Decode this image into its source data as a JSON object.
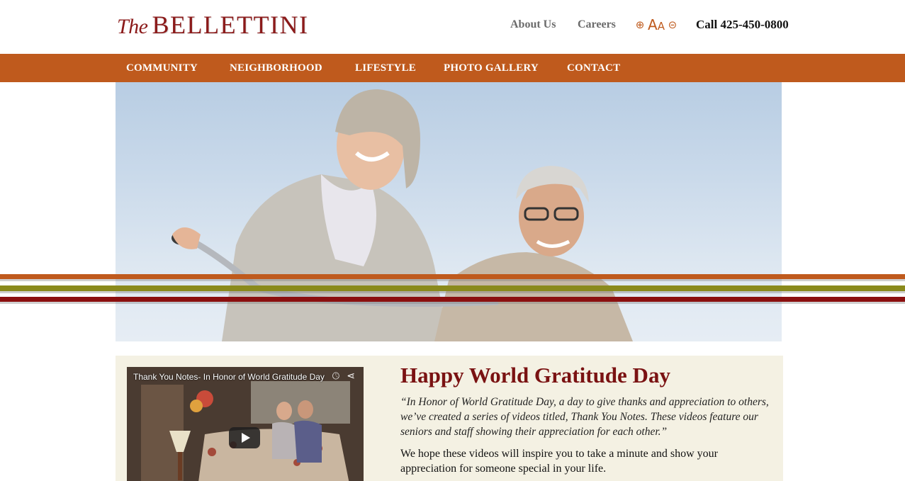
{
  "header": {
    "logo_the": "The",
    "logo_name": "BELLETTINI",
    "links": {
      "about": "About Us",
      "careers": "Careers"
    },
    "font_tools": {
      "increase": "⊕",
      "label_big": "A",
      "label_small": "A",
      "decrease": "⊝"
    },
    "call": "Call 425-450-0800"
  },
  "nav": {
    "items": [
      "COMMUNITY",
      "NEIGHBORHOOD",
      "LIFESTYLE",
      "PHOTO GALLERY",
      "CONTACT"
    ]
  },
  "hero": {
    "stripe_colors": [
      "#bf5a1d",
      "#8a8a1c",
      "#8b0f0f"
    ]
  },
  "video": {
    "title": "Thank You Notes- In Honor of World Gratitude Day",
    "clock_icon": "clock-icon",
    "share_icon": "share-icon",
    "play_icon": "play-icon"
  },
  "article": {
    "headline": "Happy World Gratitude Day",
    "quote": "“In Honor of World Gratitude Day, a day to give thanks and appreciation to others, we’ve created a series of videos titled, Thank You Notes. These videos feature our seniors and staff showing their appreciation for each other.”",
    "body": "We hope these videos will inspire you to take a minute and show your appreciation for someone special in your life."
  },
  "colors": {
    "brand": "#8b1a1a",
    "nav_bg": "#bf5a1d",
    "content_bg": "#f4f1e3"
  }
}
